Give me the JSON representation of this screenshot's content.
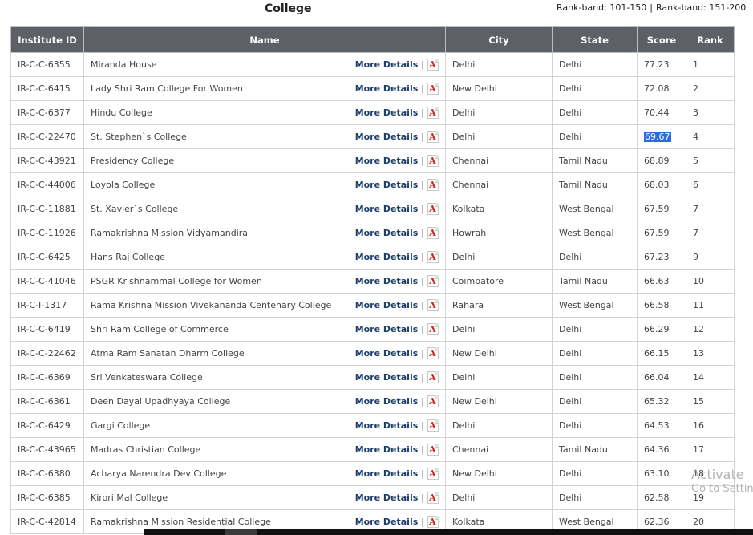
{
  "page": {
    "title": "College",
    "rank_bands": [
      "Rank-band: 101-150",
      "Rank-band: 151-200"
    ],
    "separator": "|"
  },
  "table": {
    "headers": [
      "Institute ID",
      "Name",
      "City",
      "State",
      "Score",
      "Rank"
    ],
    "more_details_label": "More Details",
    "pipe": "|",
    "pdf_icon_glyph": "A",
    "rows": [
      {
        "id": "IR-C-C-6355",
        "name": "Miranda House",
        "city": "Delhi",
        "state": "Delhi",
        "score": "77.23",
        "rank": "1"
      },
      {
        "id": "IR-C-C-6415",
        "name": "Lady Shri Ram College For Women",
        "city": "New Delhi",
        "state": "Delhi",
        "score": "72.08",
        "rank": "2"
      },
      {
        "id": "IR-C-C-6377",
        "name": "Hindu College",
        "city": "Delhi",
        "state": "Delhi",
        "score": "70.44",
        "rank": "3"
      },
      {
        "id": "IR-C-C-22470",
        "name": "St. Stephen`s College",
        "city": "Delhi",
        "state": "Delhi",
        "score": "69.67",
        "rank": "4",
        "selected": true
      },
      {
        "id": "IR-C-C-43921",
        "name": "Presidency College",
        "city": "Chennai",
        "state": "Tamil Nadu",
        "score": "68.89",
        "rank": "5"
      },
      {
        "id": "IR-C-C-44006",
        "name": "Loyola College",
        "city": "Chennai",
        "state": "Tamil Nadu",
        "score": "68.03",
        "rank": "6"
      },
      {
        "id": "IR-C-C-11881",
        "name": "St. Xavier`s College",
        "city": "Kolkata",
        "state": "West Bengal",
        "score": "67.59",
        "rank": "7"
      },
      {
        "id": "IR-C-C-11926",
        "name": "Ramakrishna Mission Vidyamandira",
        "city": "Howrah",
        "state": "West Bengal",
        "score": "67.59",
        "rank": "7"
      },
      {
        "id": "IR-C-C-6425",
        "name": "Hans Raj College",
        "city": "Delhi",
        "state": "Delhi",
        "score": "67.23",
        "rank": "9"
      },
      {
        "id": "IR-C-C-41046",
        "name": "PSGR Krishnammal College for Women",
        "city": "Coimbatore",
        "state": "Tamil Nadu",
        "score": "66.63",
        "rank": "10"
      },
      {
        "id": "IR-C-I-1317",
        "name": "Rama Krishna Mission Vivekananda Centenary College",
        "city": "Rahara",
        "state": "West Bengal",
        "score": "66.58",
        "rank": "11"
      },
      {
        "id": "IR-C-C-6419",
        "name": "Shri Ram College of Commerce",
        "city": "Delhi",
        "state": "Delhi",
        "score": "66.29",
        "rank": "12"
      },
      {
        "id": "IR-C-C-22462",
        "name": "Atma Ram Sanatan Dharm College",
        "city": "New Delhi",
        "state": "Delhi",
        "score": "66.15",
        "rank": "13"
      },
      {
        "id": "IR-C-C-6369",
        "name": "Sri Venkateswara College",
        "city": "Delhi",
        "state": "Delhi",
        "score": "66.04",
        "rank": "14"
      },
      {
        "id": "IR-C-C-6361",
        "name": "Deen Dayal Upadhyaya College",
        "city": "New Delhi",
        "state": "Delhi",
        "score": "65.32",
        "rank": "15"
      },
      {
        "id": "IR-C-C-6429",
        "name": "Gargi College",
        "city": "Delhi",
        "state": "Delhi",
        "score": "64.53",
        "rank": "16"
      },
      {
        "id": "IR-C-C-43965",
        "name": "Madras Christian College",
        "city": "Chennai",
        "state": "Tamil Nadu",
        "score": "64.36",
        "rank": "17"
      },
      {
        "id": "IR-C-C-6380",
        "name": "Acharya Narendra Dev College",
        "city": "New Delhi",
        "state": "Delhi",
        "score": "63.10",
        "rank": "18"
      },
      {
        "id": "IR-C-C-6385",
        "name": "Kirori Mal College",
        "city": "Delhi",
        "state": "Delhi",
        "score": "62.58",
        "rank": "19"
      },
      {
        "id": "IR-C-C-42814",
        "name": "Ramakrishna Mission Residential College",
        "city": "Kolkata",
        "state": "West Bengal",
        "score": "62.36",
        "rank": "20"
      }
    ]
  },
  "watermark": {
    "line1": "Activate",
    "line2": "Go to Settin"
  },
  "colors": {
    "header_bg": "#5d6066",
    "link": "#1d3d6b",
    "selection": "#2d6bd8",
    "pdf_red": "#d0231e"
  }
}
